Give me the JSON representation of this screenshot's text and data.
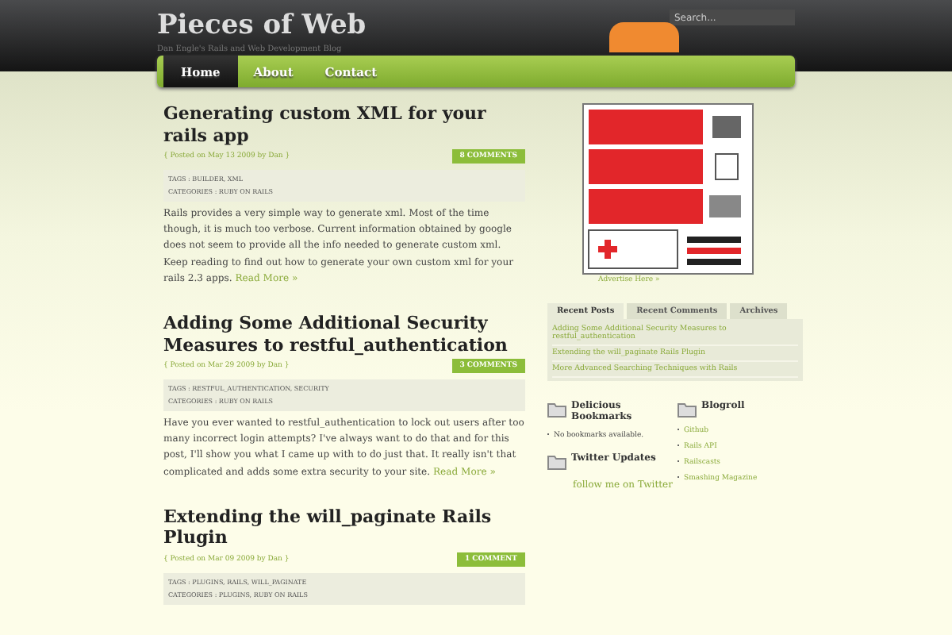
{
  "header": {
    "title": "Pieces of Web",
    "tagline": "Dan Engle's Rails and Web Development Blog",
    "search": {
      "placeholder": "Search..."
    }
  },
  "nav": [
    {
      "label": "Home",
      "selected": true
    },
    {
      "label": "About",
      "selected": false
    },
    {
      "label": "Contact",
      "selected": false
    }
  ],
  "posts": [
    {
      "title": "Generating custom XML for your rails app",
      "meta": "{ Posted on May 13 2009 by Dan }",
      "comments": "8 COMMENTS",
      "tags": "TAGS : BUILDER, XML",
      "categories": "CATEGORIES : RUBY ON RAILS",
      "body": "Rails provides a very simple way to generate xml. Most of the time though, it is much too verbose. Current information obtained by google does not seem to provide all the info needed to generate custom xml. Keep reading to find out how to generate your own custom xml for your rails 2.3 apps.",
      "more": "Read More »"
    },
    {
      "title": "Adding Some Additional Security Measures to restful_authentication",
      "meta": "{ Posted on Mar 29 2009 by Dan }",
      "comments": "3 COMMENTS",
      "tags": "TAGS : RESTFUL_AUTHENTICATION, SECURITY",
      "categories": "CATEGORIES : RUBY ON RAILS",
      "body": "Have you ever wanted to restful_authentication to lock out users after too many incorrect login attempts? I've always want to do that and for this post, I'll show you what I came up with to do just that. It really isn't that complicated and adds some extra security to your site.",
      "more": "Read More »"
    },
    {
      "title": "Extending the will_paginate Rails Plugin",
      "meta": "{ Posted on Mar 09 2009 by Dan }",
      "comments": "1 COMMENT",
      "tags": "TAGS : PLUGINS, RAILS, WILL_PAGINATE",
      "categories": "CATEGORIES : PLUGINS, RUBY ON RAILS"
    }
  ],
  "sidebar": {
    "advertise": "Advertise Here »",
    "tabs": [
      {
        "label": "Recent Posts",
        "selected": true
      },
      {
        "label": "Recent Comments",
        "selected": false
      },
      {
        "label": "Archives",
        "selected": false
      }
    ],
    "recent_posts": [
      "Adding Some Additional Security Measures to restful_authentication",
      "Extending the will_paginate Rails Plugin",
      "More Advanced Searching Techniques with Rails"
    ],
    "delicious": {
      "title": "Delicious Bookmarks",
      "items": [
        "No bookmarks available."
      ]
    },
    "twitter": {
      "title": "Twitter Updates",
      "link": "follow me on Twitter"
    },
    "blogroll": {
      "title": "Blogroll",
      "items": [
        "Github",
        "Rails API",
        "Railscasts",
        "Smashing Magazine"
      ]
    }
  }
}
